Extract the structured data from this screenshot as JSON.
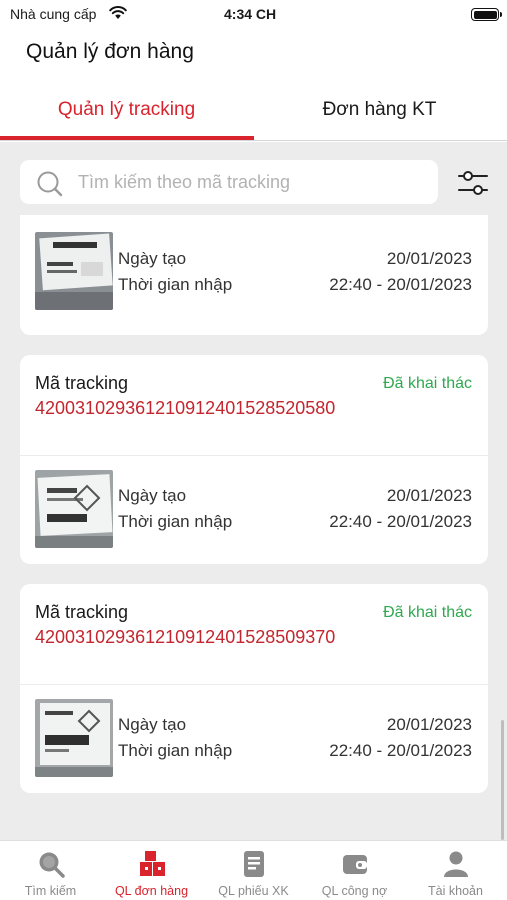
{
  "status_bar": {
    "carrier": "Nhà cung cấp",
    "time": "4:34 CH",
    "wifi_icon": "wifi-icon",
    "battery_icon": "battery-icon"
  },
  "header": {
    "title": "Quản lý đơn hàng"
  },
  "tabs": [
    {
      "label": "Quản lý tracking",
      "active": true
    },
    {
      "label": "Đơn hàng KT",
      "active": false
    }
  ],
  "search": {
    "placeholder": "Tìm kiếm theo mã tracking",
    "value": "",
    "icon": "search-icon",
    "filter_icon": "filter-sliders-icon"
  },
  "orders": [
    {
      "partial": true,
      "created_label": "Ngày tạo",
      "created_value": "20/01/2023",
      "import_label": "Thời gian nhập",
      "import_value": "22:40 - 20/01/2023"
    },
    {
      "tracking_label": "Mã tracking",
      "tracking_no": "420031029361210912401528520580",
      "status": "Đã khai thác",
      "created_label": "Ngày tạo",
      "created_value": "20/01/2023",
      "import_label": "Thời gian nhập",
      "import_value": "22:40 - 20/01/2023"
    },
    {
      "tracking_label": "Mã tracking",
      "tracking_no": "420031029361210912401528509370",
      "status": "Đã khai thác",
      "created_label": "Ngày tạo",
      "created_value": "20/01/2023",
      "import_label": "Thời gian nhập",
      "import_value": "22:40 - 20/01/2023"
    }
  ],
  "bottom_nav": [
    {
      "label": "Tìm kiếm",
      "icon": "search-icon",
      "active": false
    },
    {
      "label": "QL đơn hàng",
      "icon": "boxes-icon",
      "active": true
    },
    {
      "label": "QL phiếu XK",
      "icon": "document-icon",
      "active": false
    },
    {
      "label": "QL công nợ",
      "icon": "wallet-icon",
      "active": false
    },
    {
      "label": "Tài khoản",
      "icon": "user-icon",
      "active": false
    }
  ],
  "colors": {
    "accent": "#d9232d",
    "tracking": "#c3262e",
    "status_success": "#2fa84f",
    "background": "#ececec"
  }
}
